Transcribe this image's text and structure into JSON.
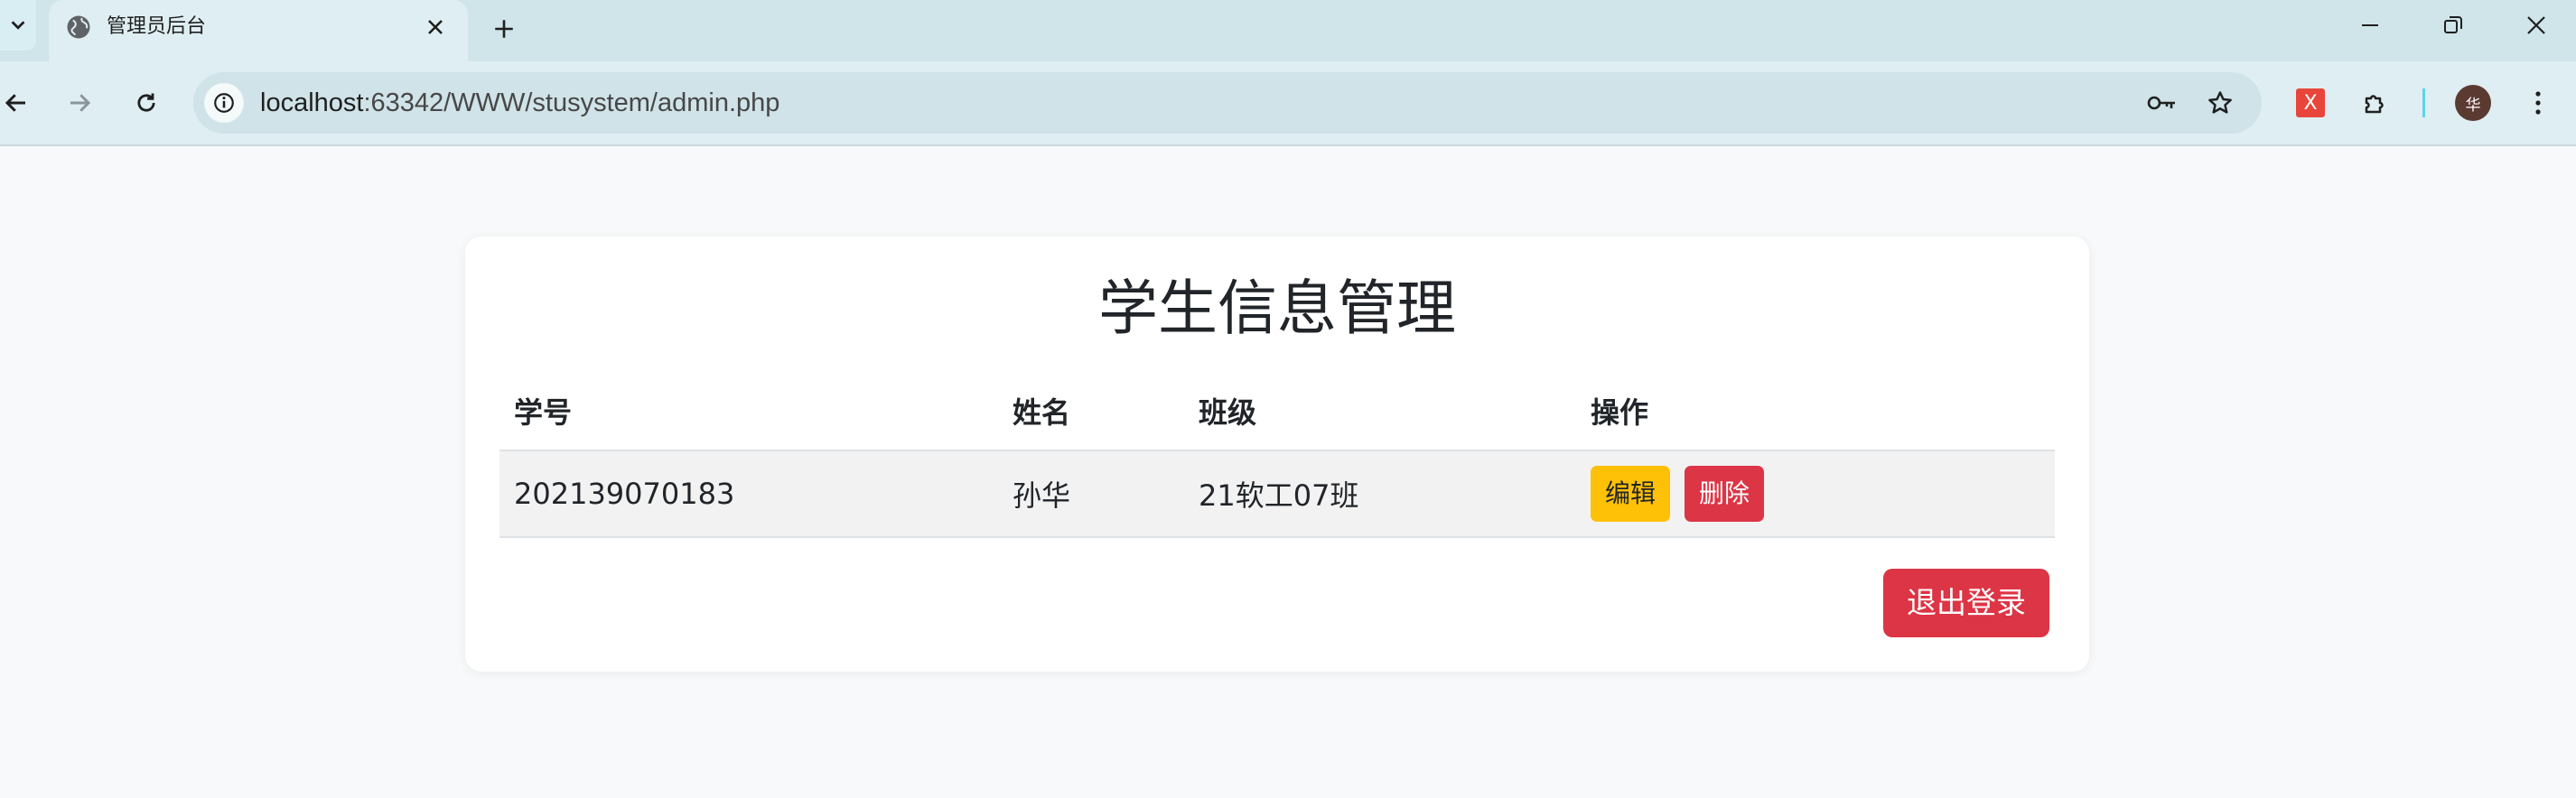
{
  "browser": {
    "tab_title": "管理员后台",
    "url_host": "localhost",
    "url_rest": ":63342/WWW/stusystem/admin.php",
    "avatar_initial": "华",
    "extension_letter": "X"
  },
  "page": {
    "title": "学生信息管理",
    "table": {
      "headers": [
        "学号",
        "姓名",
        "班级",
        "操作"
      ],
      "rows": [
        {
          "student_id": "202139070183",
          "name": "孙华",
          "class": "21软工07班"
        }
      ]
    },
    "edit_label": "编辑",
    "delete_label": "删除",
    "logout_label": "退出登录"
  },
  "colors": {
    "edit_button": "#ffc107",
    "danger": "#dc3545",
    "row_bg": "#f2f2f2"
  }
}
